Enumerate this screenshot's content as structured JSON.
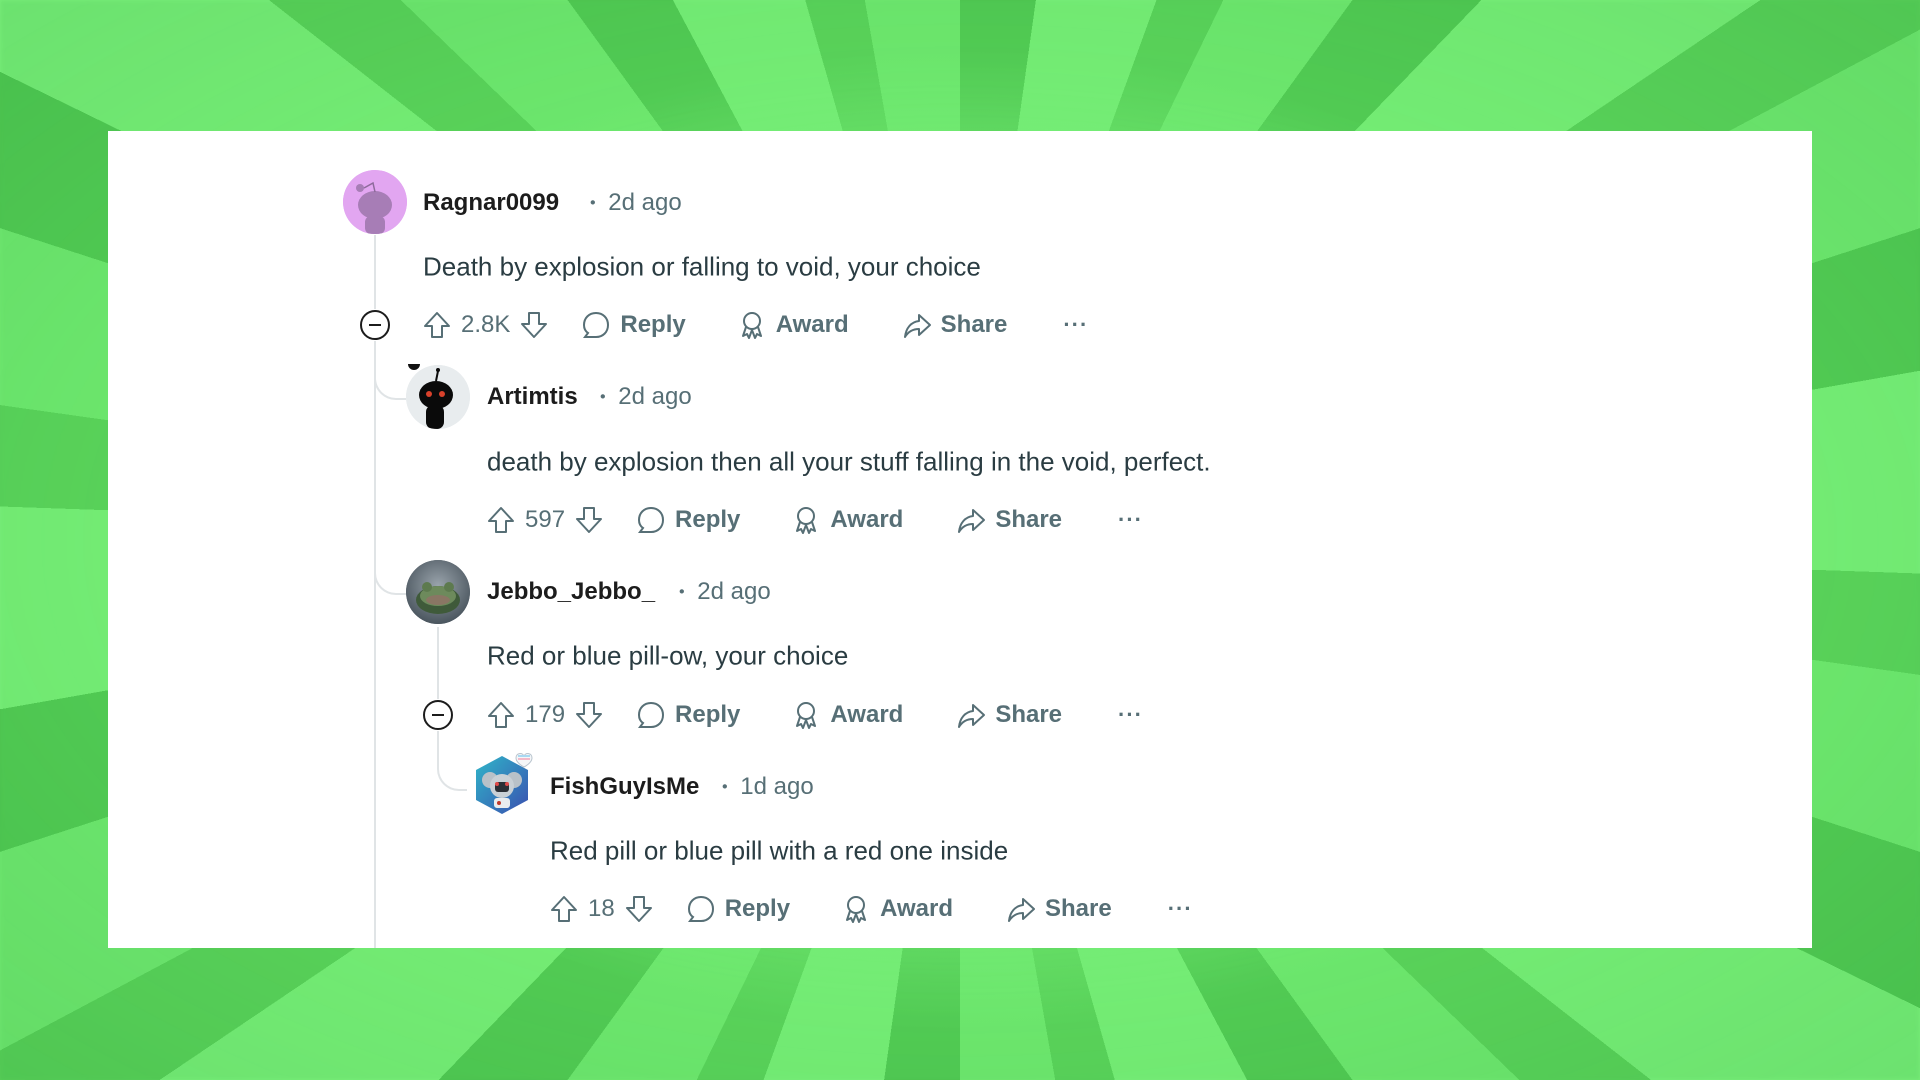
{
  "background": {
    "accent": "#78ee79"
  },
  "comments": [
    {
      "username": "Ragnar0099",
      "separator": "•",
      "age": "2d ago",
      "body": "Death by explosion or falling to void, your choice",
      "votes": "2.8K",
      "actions": {
        "reply": "Reply",
        "award": "Award",
        "share": "Share",
        "more": "···"
      },
      "avatar_icon": "snoo-avatar-purple",
      "avatar_color": "#e2a6f1",
      "collapsible": true
    },
    {
      "username": "Artimtis",
      "separator": "•",
      "age": "2d ago",
      "body": "death by explosion then all your stuff falling in the void, perfect.",
      "votes": "597",
      "actions": {
        "reply": "Reply",
        "award": "Award",
        "share": "Share",
        "more": "···"
      },
      "avatar_icon": "snoo-avatar-black",
      "avatar_color": "#e8ecee",
      "collapsible": false
    },
    {
      "username": "Jebbo_Jebbo_",
      "separator": "•",
      "age": "2d ago",
      "body": "Red or blue pill-ow, your choice",
      "votes": "179",
      "actions": {
        "reply": "Reply",
        "award": "Award",
        "share": "Share",
        "more": "···"
      },
      "avatar_icon": "frog-photo-avatar",
      "avatar_color": "#5f6b74",
      "collapsible": true
    },
    {
      "username": "FishGuyIsMe",
      "separator": "•",
      "age": "1d ago",
      "body": "Red pill or blue pill with a red one inside",
      "votes": "18",
      "actions": {
        "reply": "Reply",
        "award": "Award",
        "share": "Share",
        "more": "···"
      },
      "avatar_icon": "snoo-nft-hexagon-avatar",
      "avatar_color": "#3a6fb0",
      "collapsible": false
    }
  ],
  "colors": {
    "text_primary": "#1c1c1c",
    "text_secondary": "#576f76",
    "thread_line": "#e0e4e6"
  }
}
